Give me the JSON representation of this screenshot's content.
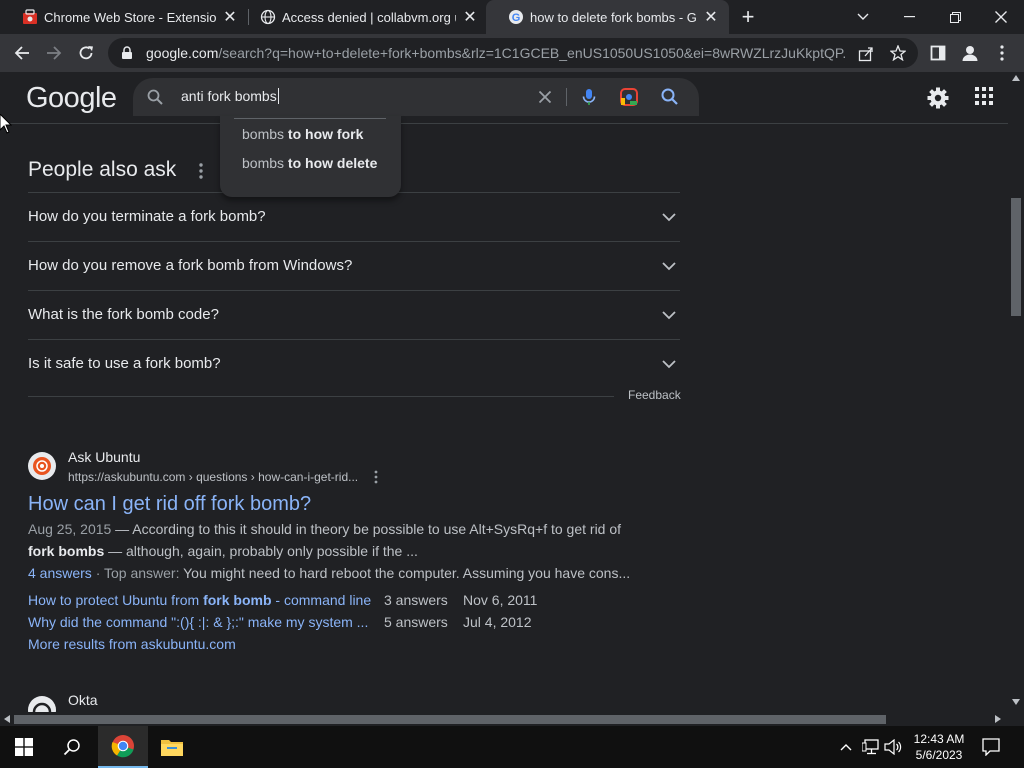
{
  "tabs": [
    {
      "title": "Chrome Web Store - Extensions",
      "favicon": "chrome-web-store-icon",
      "active": false
    },
    {
      "title": "Access denied | collabvm.org used",
      "favicon": "globe-icon",
      "active": false
    },
    {
      "title": "how to delete fork bombs - Google",
      "favicon": "google-g-icon",
      "active": true
    }
  ],
  "toolbar": {
    "url_host": "google.com",
    "url_rest": "/search?q=how+to+delete+fork+bombs&rlz=1C1GCEB_enUS1050US1050&ei=8wRWZLrzJuKkptQP..."
  },
  "google": {
    "logo": "Google",
    "query": "anti fork bombs",
    "suggestions": [
      {
        "prefix": "bombs",
        "bold": "to how fork"
      },
      {
        "prefix": "bombs",
        "bold": "to how delete"
      }
    ]
  },
  "paa": {
    "title": "People also ask",
    "questions": [
      "How do you terminate a fork bomb?",
      "How do you remove a fork bomb from Windows?",
      "What is the fork bomb code?",
      "Is it safe to use a fork bomb?"
    ],
    "feedback": "Feedback"
  },
  "result": {
    "site": "Ask Ubuntu",
    "url": "https://askubuntu.com › questions › how-can-i-get-rid...",
    "title": "How can I get rid off fork bomb?",
    "date": "Aug 25, 2015",
    "snippet1": " — According to this it should in theory be possible to use Alt+SysRq+f to get rid of",
    "snippet2_bold": "fork bombs",
    "snippet2": " — although, again, probably only possible if the ...",
    "answers_link": "4 answers",
    "answers_text": " · Top answer: ",
    "answers_snippet": "You might need to hard reboot the computer. Assuming you have cons...",
    "sublinks": [
      {
        "pre": "How to protect Ubuntu from ",
        "bold": "fork bomb",
        "post": " - command line",
        "count": "3 answers",
        "date": "Nov 6, 2011"
      },
      {
        "pre": "Why did the command \":(){ :|: & };:\" make my system ...",
        "bold": "",
        "post": "",
        "count": "5 answers",
        "date": "Jul 4, 2012"
      }
    ],
    "more": "More results from askubuntu.com"
  },
  "next_result": {
    "site": "Okta"
  },
  "taskbar": {
    "time": "12:43 AM",
    "date": "5/6/2023"
  },
  "colors": {
    "link": "#8ab4f8",
    "bg": "#202124",
    "text": "#e8eaed"
  }
}
